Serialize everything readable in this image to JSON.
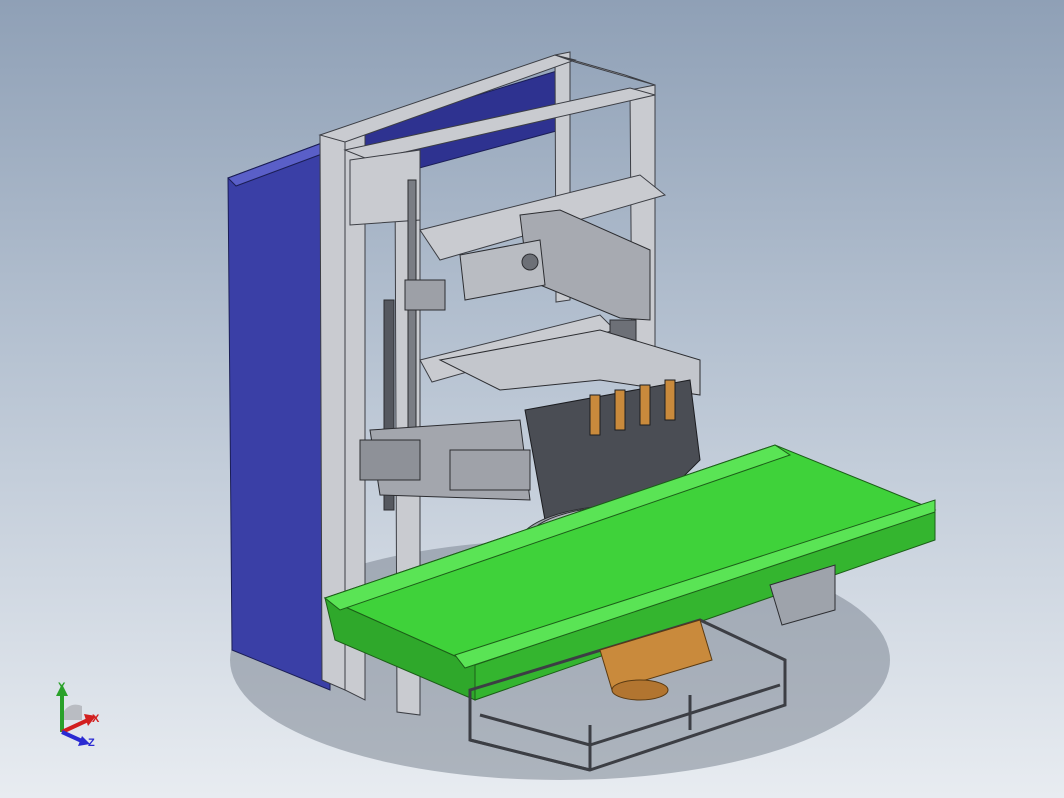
{
  "viewport": {
    "background_top": "#8fa0b6",
    "background_bottom": "#e8ecf1",
    "colors": {
      "cabinet": "#3a3fa6",
      "frame": "#c9cbd0",
      "conveyor": "#3fd23a",
      "plate": "#9ea3ab",
      "motor": "#c98a3c",
      "engine": "#4a4d54"
    }
  },
  "triad": {
    "x_label": "X",
    "y_label": "Y",
    "z_label": "Z",
    "x_color": "#d21f1f",
    "y_color": "#2aa12a",
    "z_color": "#2a2ad2"
  }
}
